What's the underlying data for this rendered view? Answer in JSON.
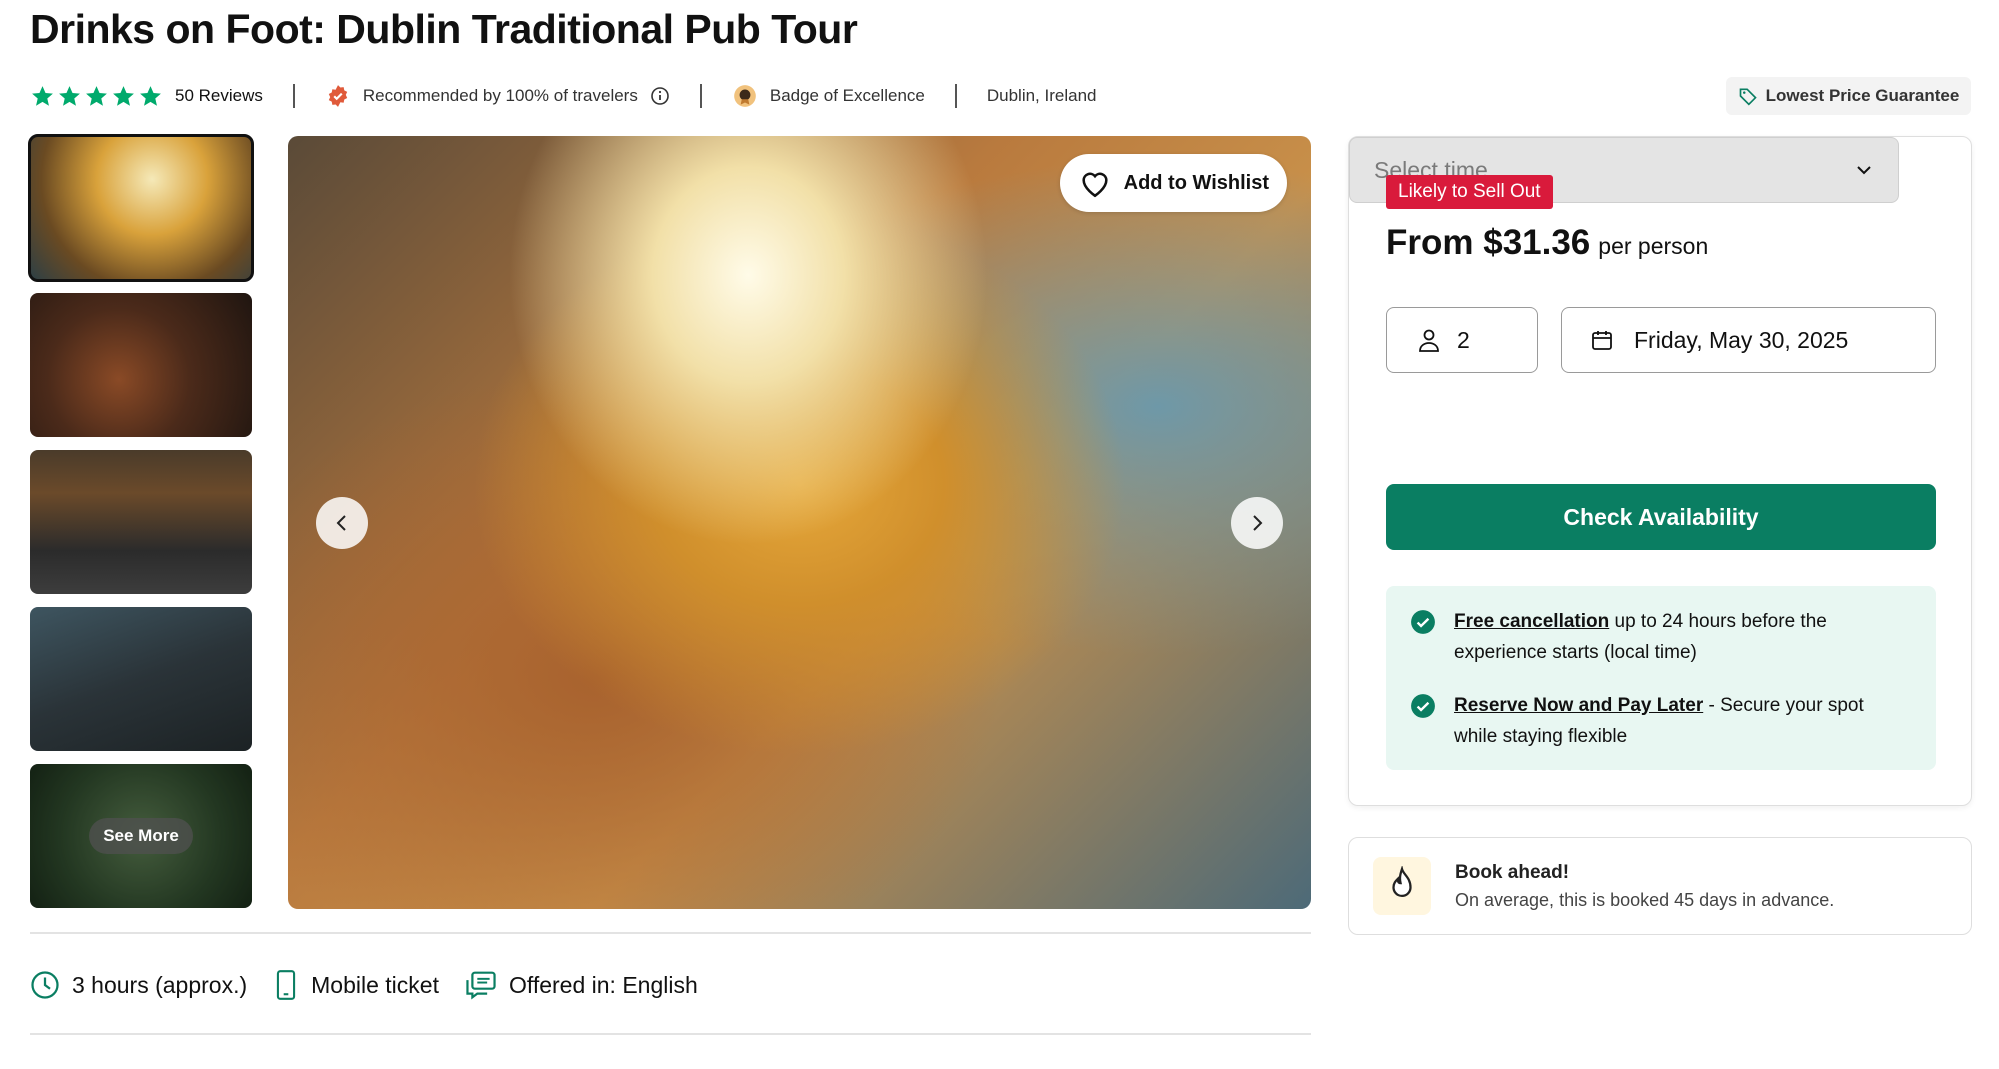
{
  "page": {
    "title": "Drinks on Foot: Dublin Traditional Pub Tour"
  },
  "meta": {
    "rating_stars": 5,
    "reviews": "50 Reviews",
    "recommended": "Recommended by 100% of travelers",
    "badge": "Badge of Excellence",
    "location": "Dublin, Ireland"
  },
  "guarantee": {
    "label": "Lowest Price Guarantee"
  },
  "gallery": {
    "see_more": "See More",
    "wishlist_label": "Add to Wishlist"
  },
  "booking": {
    "sell_out_badge": "Likely to Sell Out",
    "price": "From $31.36",
    "price_unit": "per person",
    "travelers_count": "2",
    "date": "Friday, May 30, 2025",
    "time_placeholder": "Select time",
    "check_button": "Check Availability",
    "perks": [
      {
        "title": "Free cancellation",
        "text": " up to 24 hours before the experience starts (local time)"
      },
      {
        "title": "Reserve Now and Pay Later",
        "text": " - Secure your spot while staying flexible"
      }
    ]
  },
  "book_ahead": {
    "title": "Book ahead!",
    "subtitle": "On average, this is booked 45 days in advance."
  },
  "features": {
    "duration": "3 hours (approx.)",
    "ticket": "Mobile ticket",
    "language": "Offered in: English"
  },
  "colors": {
    "brand_green": "#0a7e62",
    "star_green": "#00aa6c",
    "sell_out_red": "#d91a3b",
    "perks_bg": "#e8f7f2"
  }
}
